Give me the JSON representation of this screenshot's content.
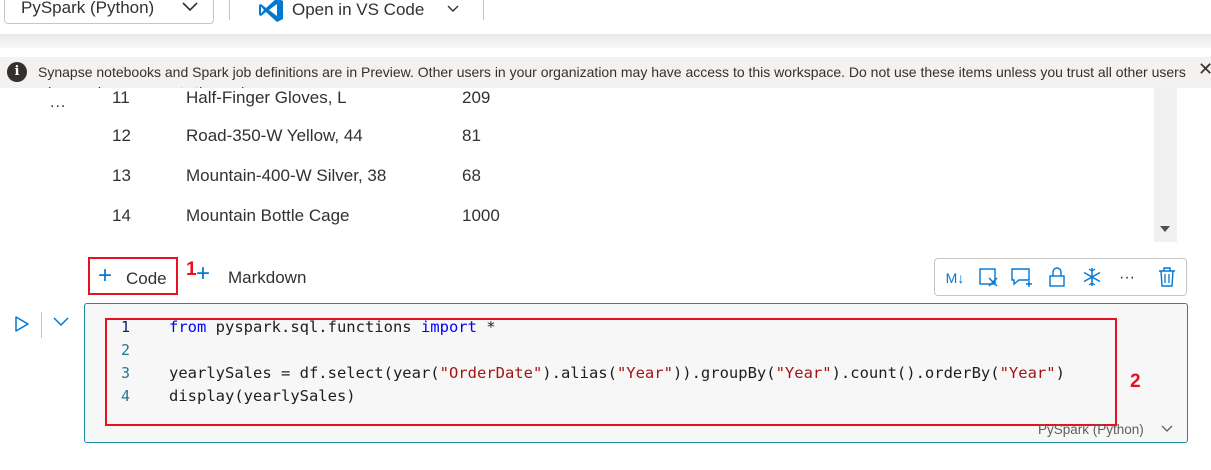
{
  "toolbar": {
    "language_label": "PySpark (Python)",
    "vscode_label": "Open in VS Code"
  },
  "banner": {
    "message": "Synapse notebooks and Spark job definitions are in Preview. Other users in your organization may have access to this workspace. Do not use these items unless you trust all other users who may have access to the workspace.",
    "close_glyph": "✕",
    "info_glyph": "i"
  },
  "output": {
    "more_glyph": "...",
    "rows": [
      {
        "index": "11",
        "product": "Half-Finger Gloves, L",
        "quantity": "209"
      },
      {
        "index": "12",
        "product": "Road-350-W Yellow, 44",
        "quantity": "81"
      },
      {
        "index": "13",
        "product": "Mountain-400-W Silver, 38",
        "quantity": "68"
      },
      {
        "index": "14",
        "product": "Mountain Bottle Cage",
        "quantity": "1000"
      }
    ]
  },
  "add_cell": {
    "code_label": "Code",
    "markdown_label": "Markdown",
    "plus_glyph": "+"
  },
  "callouts": {
    "one": "1",
    "two": "2"
  },
  "cell_toolbar": {
    "markdown_toggle": "M↓",
    "more_glyph": "···"
  },
  "code_cell": {
    "line_numbers": [
      "1",
      "2",
      "3",
      "4"
    ],
    "language_label": "PySpark (Python)"
  },
  "colors": {
    "accent": "#0078d4",
    "callout_red": "#e81123",
    "cell_border": "#1b8e9e"
  }
}
